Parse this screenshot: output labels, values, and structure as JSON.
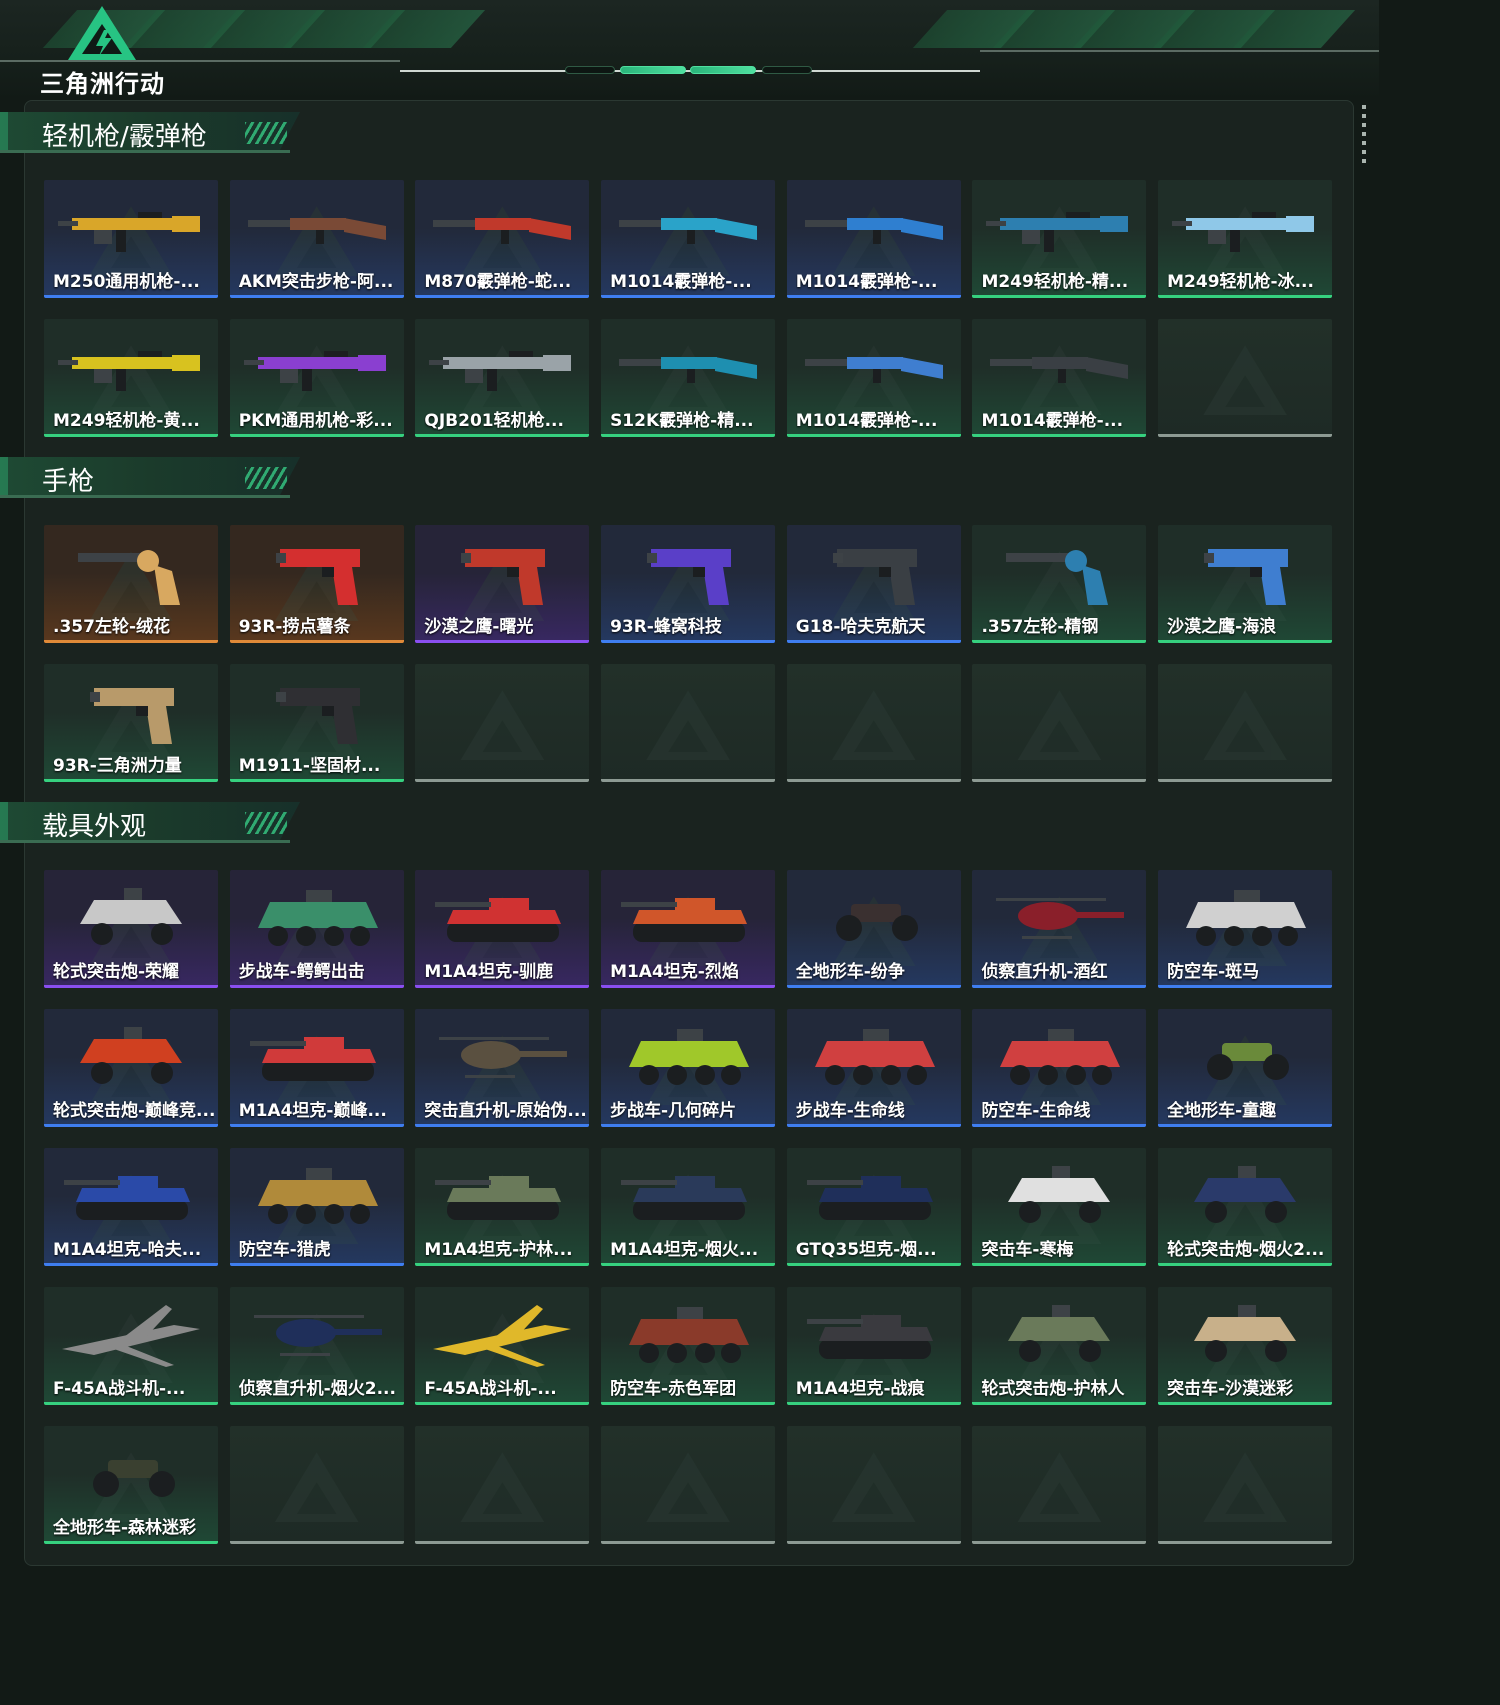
{
  "app": {
    "logo_text": "三角洲行动",
    "brand_color": "#2fc483"
  },
  "rarity_colors": {
    "gold": "#e08a38",
    "purple": "#8a4ff0",
    "blue": "#3f7ef0",
    "green": "#36d17f"
  },
  "sections": [
    {
      "title": "轻机枪/霰弹枪",
      "items": [
        {
          "label": "M250通用机枪-...",
          "rarity": "blue",
          "icon": "machine-gun-icon",
          "color": "#d9a629"
        },
        {
          "label": "AKM突击步枪-阿...",
          "rarity": "blue",
          "icon": "rifle-icon",
          "color": "#7a4a36"
        },
        {
          "label": "M870霰弹枪-蛇...",
          "rarity": "blue",
          "icon": "shotgun-icon",
          "color": "#c0392b"
        },
        {
          "label": "M1014霰弹枪-...",
          "rarity": "blue",
          "icon": "shotgun-icon",
          "color": "#2aa3c9"
        },
        {
          "label": "M1014霰弹枪-...",
          "rarity": "blue",
          "icon": "shotgun-icon",
          "color": "#2f7fd0"
        },
        {
          "label": "M249轻机枪-精...",
          "rarity": "green",
          "icon": "machine-gun-icon",
          "color": "#2d7fb0"
        },
        {
          "label": "M249轻机枪-冰...",
          "rarity": "green",
          "icon": "machine-gun-icon",
          "color": "#8fc8e8"
        },
        {
          "label": "M249轻机枪-黄...",
          "rarity": "green",
          "icon": "machine-gun-icon",
          "color": "#d8c21f"
        },
        {
          "label": "PKM通用机枪-彩...",
          "rarity": "green",
          "icon": "machine-gun-icon",
          "color": "#8a3fd0"
        },
        {
          "label": "QJB201轻机枪...",
          "rarity": "green",
          "icon": "machine-gun-icon",
          "color": "#9aa3a8"
        },
        {
          "label": "S12K霰弹枪-精...",
          "rarity": "green",
          "icon": "shotgun-icon",
          "color": "#1e8fb0"
        },
        {
          "label": "M1014霰弹枪-...",
          "rarity": "green",
          "icon": "shotgun-icon",
          "color": "#3f7ed0"
        },
        {
          "label": "M1014霰弹枪-...",
          "rarity": "green",
          "icon": "shotgun-icon",
          "color": "#3a3f44"
        },
        {
          "label": "",
          "rarity": "none",
          "icon": "",
          "color": ""
        }
      ]
    },
    {
      "title": "手枪",
      "items": [
        {
          "label": ".357左轮-绒花",
          "rarity": "gold",
          "icon": "revolver-icon",
          "color": "#d8a860"
        },
        {
          "label": "93R-捞点薯条",
          "rarity": "gold",
          "icon": "pistol-icon",
          "color": "#d42f2f"
        },
        {
          "label": "沙漠之鹰-曙光",
          "rarity": "purple",
          "icon": "pistol-icon",
          "color": "#c0392b"
        },
        {
          "label": "93R-蜂窝科技",
          "rarity": "blue",
          "icon": "pistol-icon",
          "color": "#5a3fc8"
        },
        {
          "label": "G18-哈夫克航天",
          "rarity": "blue",
          "icon": "pistol-icon",
          "color": "#3a3f44"
        },
        {
          "label": ".357左轮-精钢",
          "rarity": "green",
          "icon": "revolver-icon",
          "color": "#2d7fb0"
        },
        {
          "label": "沙漠之鹰-海浪",
          "rarity": "green",
          "icon": "pistol-icon",
          "color": "#3f7ed0"
        },
        {
          "label": "93R-三角洲力量",
          "rarity": "green",
          "icon": "pistol-icon",
          "color": "#b89a6a"
        },
        {
          "label": "M1911-坚固材...",
          "rarity": "green",
          "icon": "pistol-icon",
          "color": "#2f2f33"
        },
        {
          "label": "",
          "rarity": "none",
          "icon": "",
          "color": ""
        },
        {
          "label": "",
          "rarity": "none",
          "icon": "",
          "color": ""
        },
        {
          "label": "",
          "rarity": "none",
          "icon": "",
          "color": ""
        },
        {
          "label": "",
          "rarity": "none",
          "icon": "",
          "color": ""
        },
        {
          "label": "",
          "rarity": "none",
          "icon": "",
          "color": ""
        }
      ]
    },
    {
      "title": "载具外观",
      "items": [
        {
          "label": "轮式突击炮-荣耀",
          "rarity": "purple",
          "icon": "armored-car-icon",
          "color": "#c8c8c8"
        },
        {
          "label": "步战车-鳄鳄出击",
          "rarity": "purple",
          "icon": "ifv-icon",
          "color": "#3a8f6a"
        },
        {
          "label": "M1A4坦克-驯鹿",
          "rarity": "purple",
          "icon": "tank-icon",
          "color": "#d03232"
        },
        {
          "label": "M1A4坦克-烈焰",
          "rarity": "purple",
          "icon": "tank-icon",
          "color": "#d0562a"
        },
        {
          "label": "全地形车-纷争",
          "rarity": "blue",
          "icon": "atv-icon",
          "color": "#3a3030"
        },
        {
          "label": "侦察直升机-酒红",
          "rarity": "blue",
          "icon": "helicopter-icon",
          "color": "#8a1f2a"
        },
        {
          "label": "防空车-斑马",
          "rarity": "blue",
          "icon": "ifv-icon",
          "color": "#d0d0d0"
        },
        {
          "label": "轮式突击炮-巅峰竞...",
          "rarity": "blue",
          "icon": "armored-car-icon",
          "color": "#d04020"
        },
        {
          "label": "M1A4坦克-巅峰...",
          "rarity": "blue",
          "icon": "tank-icon",
          "color": "#d03a3a"
        },
        {
          "label": "突击直升机-原始伪...",
          "rarity": "blue",
          "icon": "helicopter-icon",
          "color": "#5a5040"
        },
        {
          "label": "步战车-几何碎片",
          "rarity": "blue",
          "icon": "ifv-icon",
          "color": "#a0c82a"
        },
        {
          "label": "步战车-生命线",
          "rarity": "blue",
          "icon": "ifv-icon",
          "color": "#d04040"
        },
        {
          "label": "防空车-生命线",
          "rarity": "blue",
          "icon": "ifv-icon",
          "color": "#d04040"
        },
        {
          "label": "全地形车-童趣",
          "rarity": "blue",
          "icon": "atv-icon",
          "color": "#6a8a3a"
        },
        {
          "label": "M1A4坦克-哈夫...",
          "rarity": "blue",
          "icon": "tank-icon",
          "color": "#2a4aa8"
        },
        {
          "label": "防空车-猎虎",
          "rarity": "blue",
          "icon": "ifv-icon",
          "color": "#b08a3a"
        },
        {
          "label": "M1A4坦克-护林...",
          "rarity": "green",
          "icon": "tank-icon",
          "color": "#6a7a5a"
        },
        {
          "label": "M1A4坦克-烟火...",
          "rarity": "green",
          "icon": "tank-icon",
          "color": "#2a3a5a"
        },
        {
          "label": "GTQ35坦克-烟...",
          "rarity": "green",
          "icon": "tank-icon",
          "color": "#1f2f5a"
        },
        {
          "label": "突击车-寒梅",
          "rarity": "green",
          "icon": "armored-car-icon",
          "color": "#e0e0e0"
        },
        {
          "label": "轮式突击炮-烟火2...",
          "rarity": "green",
          "icon": "armored-car-icon",
          "color": "#2a3a6a"
        },
        {
          "label": "F-45A战斗机-...",
          "rarity": "green",
          "icon": "jet-icon",
          "color": "#8a8a8a"
        },
        {
          "label": "侦察直升机-烟火2...",
          "rarity": "green",
          "icon": "helicopter-icon",
          "color": "#1f2f5a"
        },
        {
          "label": "F-45A战斗机-...",
          "rarity": "green",
          "icon": "jet-icon",
          "color": "#e0b82a"
        },
        {
          "label": "防空车-赤色军团",
          "rarity": "green",
          "icon": "ifv-icon",
          "color": "#8a3a2a"
        },
        {
          "label": "M1A4坦克-战痕",
          "rarity": "green",
          "icon": "tank-icon",
          "color": "#3a3a3f"
        },
        {
          "label": "轮式突击炮-护林人",
          "rarity": "green",
          "icon": "armored-car-icon",
          "color": "#6a7a5a"
        },
        {
          "label": "突击车-沙漠迷彩",
          "rarity": "green",
          "icon": "armored-car-icon",
          "color": "#c8b08a"
        },
        {
          "label": "全地形车-森林迷彩",
          "rarity": "green",
          "icon": "atv-icon",
          "color": "#3a4030"
        },
        {
          "label": "",
          "rarity": "none",
          "icon": "",
          "color": ""
        },
        {
          "label": "",
          "rarity": "none",
          "icon": "",
          "color": ""
        },
        {
          "label": "",
          "rarity": "none",
          "icon": "",
          "color": ""
        },
        {
          "label": "",
          "rarity": "none",
          "icon": "",
          "color": ""
        },
        {
          "label": "",
          "rarity": "none",
          "icon": "",
          "color": ""
        },
        {
          "label": "",
          "rarity": "none",
          "icon": "",
          "color": ""
        }
      ]
    }
  ]
}
